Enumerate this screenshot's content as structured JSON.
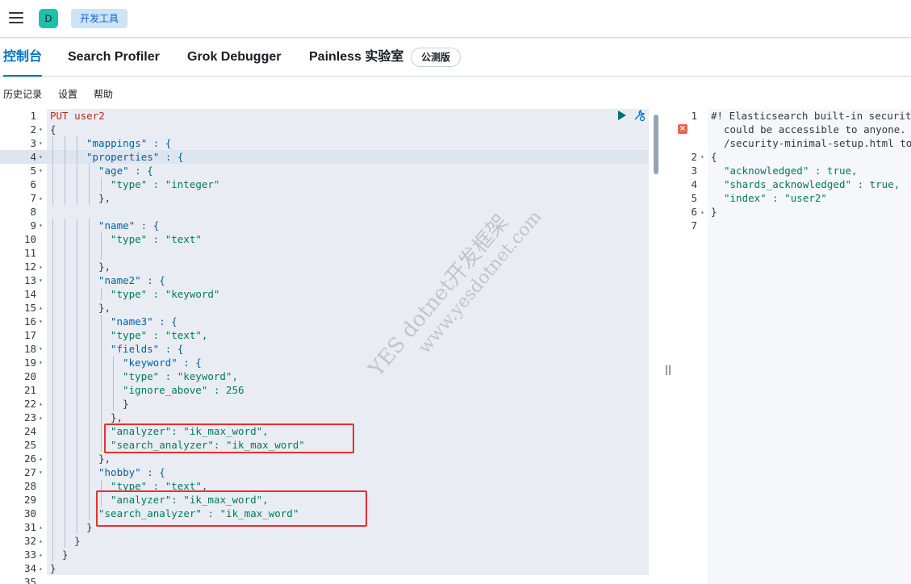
{
  "header": {
    "avatar_letter": "D",
    "breadcrumb": "开发工具"
  },
  "tabs": [
    {
      "label": "控制台",
      "active": true
    },
    {
      "label": "Search Profiler"
    },
    {
      "label": "Grok Debugger"
    },
    {
      "label": "Painless 实验室"
    }
  ],
  "beta_badge": "公测版",
  "toolbar": {
    "history": "历史记录",
    "settings": "设置",
    "help": "帮助"
  },
  "editor": {
    "line_numbers": [
      "1",
      "2",
      "3",
      "4",
      "5",
      "6",
      "7",
      "8",
      "9",
      "10",
      "11",
      "12",
      "13",
      "14",
      "15",
      "16",
      "17",
      "18",
      "19",
      "20",
      "21",
      "22",
      "23",
      "24",
      "25",
      "26",
      "27",
      "28",
      "29",
      "30",
      "31",
      "32",
      "33",
      "34",
      "35"
    ],
    "lines": [
      "PUT user2",
      "{",
      "\"mappings\" : {",
      "\"properties\" : {",
      "\"age\" : {",
      "\"type\" : \"integer\"",
      "},",
      "",
      "\"name\" : {",
      "\"type\" : \"text\"",
      "",
      "},",
      "\"name2\" : {",
      "\"type\" : \"keyword\"",
      "},",
      "\"name3\" : {",
      "\"type\" : \"text\",",
      "\"fields\" : {",
      "\"keyword\" : {",
      "\"type\" : \"keyword\",",
      "\"ignore_above\" : 256",
      "}",
      "},",
      "\"analyzer\": \"ik_max_word\",",
      "\"search_analyzer\": \"ik_max_word\"",
      "},",
      "\"hobby\" : {",
      "\"type\" : \"text\",",
      "\"analyzer\": \"ik_max_word\",",
      "\"search_analyzer\" : \"ik_max_word\"",
      "}",
      "}",
      "}",
      "}",
      ""
    ]
  },
  "output": {
    "line_numbers": [
      "1",
      "",
      "",
      "2",
      "3",
      "4",
      "5",
      "6",
      "7"
    ],
    "lines": [
      "#! Elasticsearch built-in securit",
      "could be accessible to anyone.",
      "/security-minimal-setup.html to",
      "{",
      "\"acknowledged\" : true,",
      "\"shards_acknowledged\" : true,",
      "\"index\" : \"user2\"",
      "}",
      ""
    ]
  },
  "watermark": {
    "line1": "YES dotnet开发框架",
    "line2": "www.yesdotnet.com"
  },
  "colors": {
    "accent": "#0071c2",
    "highlight_box": "#e7302f",
    "avatar": "#20bfa9"
  }
}
